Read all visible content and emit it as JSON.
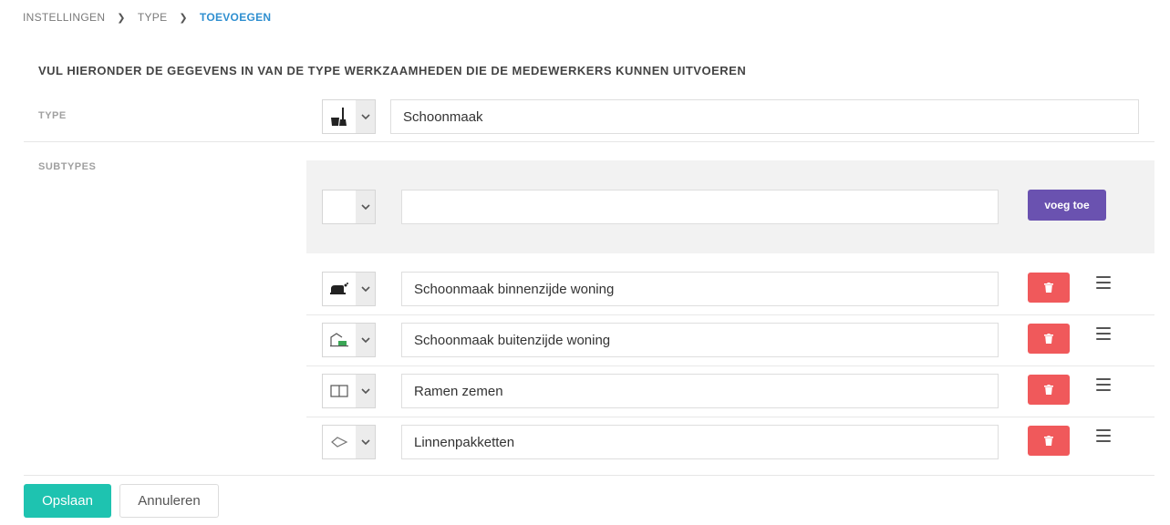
{
  "breadcrumb": {
    "items": [
      "INSTELLINGEN",
      "TYPE",
      "TOEVOEGEN"
    ]
  },
  "heading": "VUL HIERONDER DE GEGEVENS IN VAN DE TYPE WERKZAAMHEDEN DIE DE MEDEWERKERS KUNNEN UITVOEREN",
  "type_field": {
    "label": "TYPE",
    "icon": "cleaning-bucket-broom-icon",
    "value": "Schoonmaak"
  },
  "subtypes": {
    "label": "SUBTYPES",
    "new_entry": {
      "icon": "",
      "value": "",
      "placeholder": "",
      "add_label": "voeg toe"
    },
    "items": [
      {
        "icon": "indoor-cleaning-icon",
        "value": "Schoonmaak binnenzijde woning"
      },
      {
        "icon": "outdoor-cleaning-icon",
        "value": "Schoonmaak buitenzijde woning"
      },
      {
        "icon": "window-icon",
        "value": "Ramen zemen"
      },
      {
        "icon": "linen-package-icon",
        "value": "Linnenpakketten"
      }
    ]
  },
  "footer": {
    "save_label": "Opslaan",
    "cancel_label": "Annuleren"
  },
  "colors": {
    "accent_blue": "#2f8fd0",
    "add_button": "#6a52b0",
    "delete_button": "#f0595b",
    "save_button": "#1ec3b0"
  }
}
